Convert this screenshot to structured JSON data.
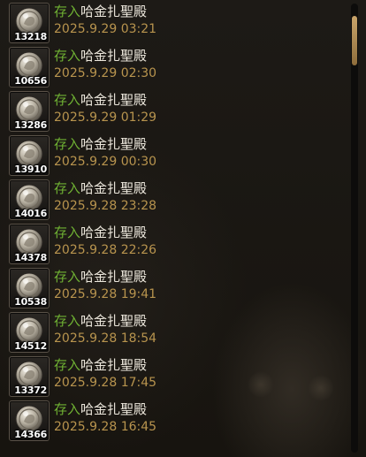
{
  "item": {
    "icon": "silver-coin-icon"
  },
  "colors": {
    "action": "#6fb133",
    "place": "#ece7dc",
    "time": "#b8944e"
  },
  "logs": [
    {
      "qty": "13218",
      "action": "存入",
      "place": "哈金扎聖殿",
      "time": "2025.9.29 03:21"
    },
    {
      "qty": "10656",
      "action": "存入",
      "place": "哈金扎聖殿",
      "time": "2025.9.29 02:30"
    },
    {
      "qty": "13286",
      "action": "存入",
      "place": "哈金扎聖殿",
      "time": "2025.9.29 01:29"
    },
    {
      "qty": "13910",
      "action": "存入",
      "place": "哈金扎聖殿",
      "time": "2025.9.29 00:30"
    },
    {
      "qty": "14016",
      "action": "存入",
      "place": "哈金扎聖殿",
      "time": "2025.9.28 23:28"
    },
    {
      "qty": "14378",
      "action": "存入",
      "place": "哈金扎聖殿",
      "time": "2025.9.28 22:26"
    },
    {
      "qty": "10538",
      "action": "存入",
      "place": "哈金扎聖殿",
      "time": "2025.9.28 19:41"
    },
    {
      "qty": "14512",
      "action": "存入",
      "place": "哈金扎聖殿",
      "time": "2025.9.28 18:54"
    },
    {
      "qty": "13372",
      "action": "存入",
      "place": "哈金扎聖殿",
      "time": "2025.9.28 17:45"
    },
    {
      "qty": "14366",
      "action": "存入",
      "place": "哈金扎聖殿",
      "time": "2025.9.28 16:45"
    }
  ]
}
